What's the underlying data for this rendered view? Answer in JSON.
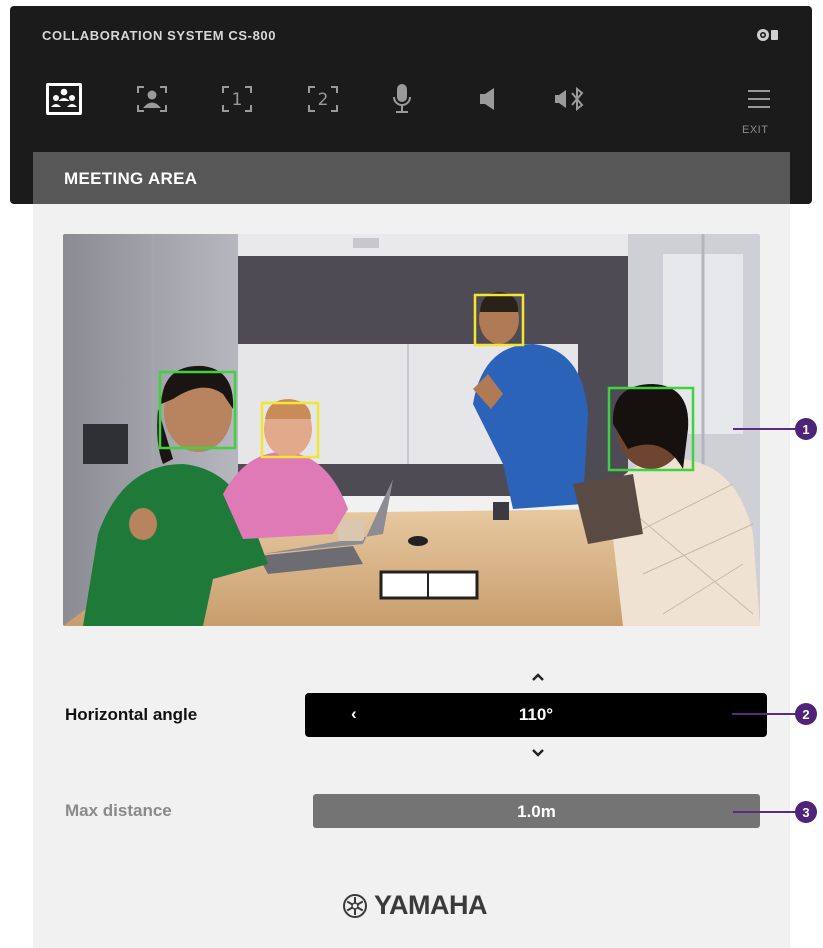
{
  "app": {
    "title": "COLLABORATION SYSTEM CS-800"
  },
  "toolbar": {
    "items": [
      {
        "icon": "meeting-area-icon",
        "active": true
      },
      {
        "icon": "single-person-frame-icon",
        "active": false
      },
      {
        "icon": "frame-one-icon",
        "label": "1"
      },
      {
        "icon": "frame-two-icon",
        "label": "2"
      },
      {
        "icon": "microphone-icon"
      },
      {
        "icon": "speaker-icon"
      },
      {
        "icon": "bluetooth-speaker-icon"
      },
      {
        "icon": "menu-icon"
      }
    ],
    "exit_label": "EXIT"
  },
  "panel": {
    "title": "MEETING AREA"
  },
  "settings": {
    "horizontal_angle": {
      "label": "Horizontal angle",
      "value": "110°"
    },
    "max_distance": {
      "label": "Max distance",
      "value": "1.0m"
    }
  },
  "brand": {
    "name": "YAMAHA"
  },
  "callouts": [
    "1",
    "2",
    "3"
  ],
  "colors": {
    "header_bg": "#1b1b1b",
    "panel_bg": "#f1f1f1",
    "panel_head": "#575757",
    "callout": "#4f2378",
    "face_box_green": "#3fd23f",
    "face_box_yellow": "#f2e631"
  }
}
